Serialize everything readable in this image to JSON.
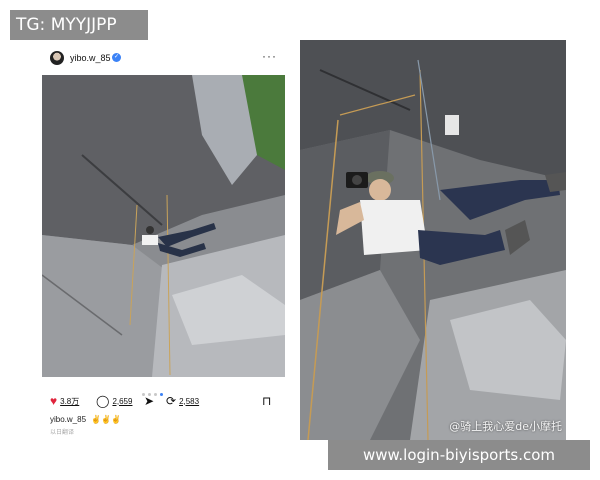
{
  "banner": {
    "tag": "TG: MYYJJPP"
  },
  "post": {
    "username": "yibo.w_85",
    "verified_mark": "✓",
    "more_icon": "···",
    "carousel": {
      "count": 4,
      "active": 3
    },
    "actions": {
      "likes": "3.8万",
      "comments": "2,659",
      "reposts": "2,583"
    },
    "caption": {
      "user": "yibo.w_85",
      "emoji": "✌✌✌"
    },
    "subline": "以日翻译"
  },
  "closeup": {
    "watermark": "@骑上我心爱de小摩托"
  },
  "footer": {
    "url": "www.login-biyisports.com"
  },
  "colors": {
    "banner_bg": "#8c8c8c",
    "like_red": "#e0243c",
    "verified_blue": "#3b82f6",
    "rock_gray": "#7e8085"
  }
}
